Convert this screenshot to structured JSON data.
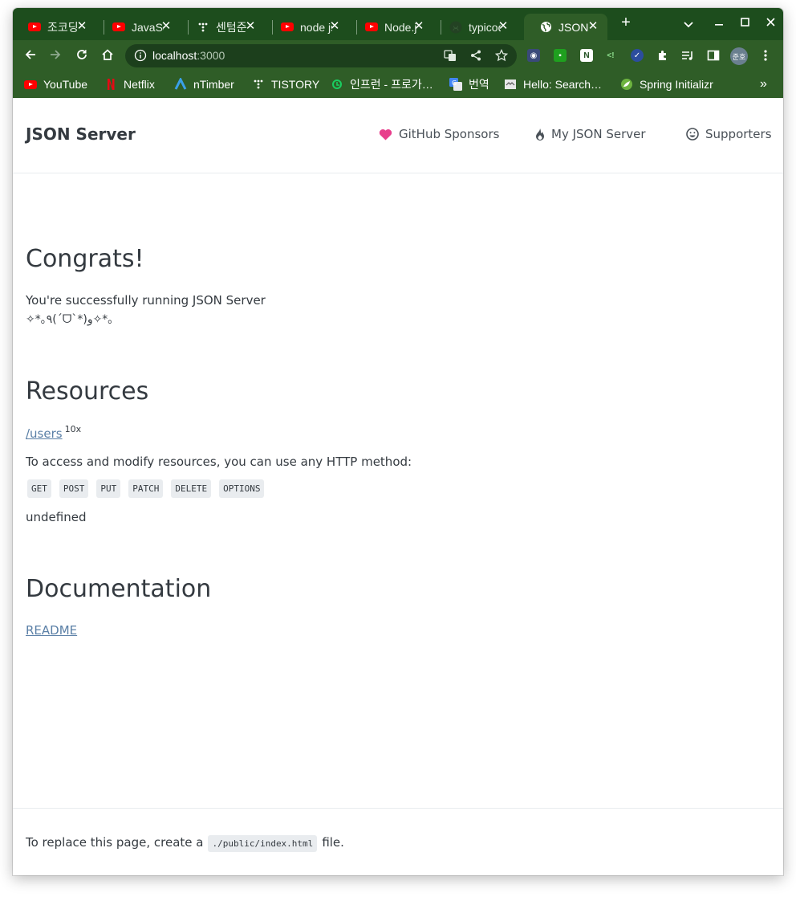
{
  "browser": {
    "tabs": [
      {
        "title": "조코딩",
        "icon": "youtube-icon"
      },
      {
        "title": "JavaScript",
        "icon": "youtube-icon"
      },
      {
        "title": "센텀준",
        "icon": "tistory-icon"
      },
      {
        "title": "node js",
        "icon": "youtube-icon"
      },
      {
        "title": "Node.js",
        "icon": "youtube-icon"
      },
      {
        "title": "typicode",
        "icon": "github-icon"
      },
      {
        "title": "JSON",
        "icon": "globe-icon"
      }
    ],
    "new_tab": "+",
    "url_host": "localhost",
    "url_port": ":3000",
    "profile_initials": "준호",
    "bookmarks": [
      {
        "label": "YouTube",
        "icon": "youtube-icon"
      },
      {
        "label": "Netflix",
        "icon": "netflix-icon"
      },
      {
        "label": "nTimber",
        "icon": "ntimber-icon"
      },
      {
        "label": "TISTORY",
        "icon": "tistory-icon"
      },
      {
        "label": "인프런 - 프로가…",
        "icon": "inflearn-icon"
      },
      {
        "label": "번역",
        "icon": "translate-icon"
      },
      {
        "label": "Hello: Search…",
        "icon": "page-icon"
      },
      {
        "label": "Spring Initializr",
        "icon": "spring-icon"
      }
    ],
    "more_bookmarks": "»",
    "colors": {
      "frame": "#1d4d1d",
      "toolbar": "#2f5d27",
      "omnibox": "#1c3f1c"
    }
  },
  "site": {
    "brand": "JSON Server",
    "nav": [
      {
        "label": "GitHub Sponsors",
        "icon": "heart-icon"
      },
      {
        "label": "My JSON Server",
        "icon": "flame-icon"
      },
      {
        "label": "Supporters",
        "icon": "smiley-icon"
      }
    ],
    "congrats_title": "Congrats!",
    "congrats_text": "You're successfully running JSON Server",
    "kaomoji": "✧*｡٩(ˊᗜˋ*)و✧*｡",
    "resources_title": "Resources",
    "resource_link": "/users",
    "resource_count": "10x",
    "methods_text": "To access and modify resources, you can use any HTTP method:",
    "methods": [
      "GET",
      "POST",
      "PUT",
      "PATCH",
      "DELETE",
      "OPTIONS"
    ],
    "undefined_text": "undefined",
    "docs_title": "Documentation",
    "readme_link": "README",
    "footer_prefix": "To replace this page, create a",
    "footer_code": "./public/index.html",
    "footer_suffix": "file.",
    "colors": {
      "text": "#343a40",
      "link": "#5a7fa6",
      "heart": "#e83e8c"
    }
  }
}
